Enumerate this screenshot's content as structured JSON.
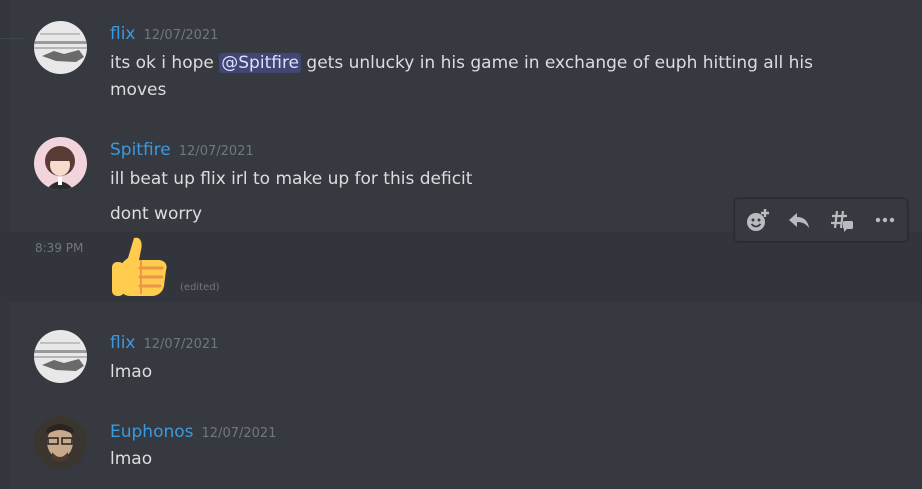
{
  "messages": [
    {
      "username": "flix",
      "timestamp": "12/07/2021",
      "text_before": "its ok i hope ",
      "mention": "@Spitfire",
      "text_after": " gets unlucky in his game in exchange of euph hitting all his moves"
    },
    {
      "username": "Spitfire",
      "timestamp": "12/07/2021",
      "lines": [
        "ill beat up flix irl to make up for this deficit",
        "dont worry"
      ]
    },
    {
      "hover_time": "8:39 PM",
      "emoji_name": "thumbs-up",
      "edited": "(edited)"
    },
    {
      "username": "flix",
      "timestamp": "12/07/2021",
      "text": "lmao"
    },
    {
      "username": "Euphonos",
      "timestamp": "12/07/2021",
      "text": "lmao"
    }
  ],
  "toolbar": {
    "icons": [
      "add-reaction-icon",
      "reply-icon",
      "create-thread-icon",
      "more-icon"
    ]
  },
  "colors": {
    "background": "#36393f",
    "username": "#3a9ae0",
    "mention_bg": "#414675",
    "timestamp": "#72767d"
  }
}
